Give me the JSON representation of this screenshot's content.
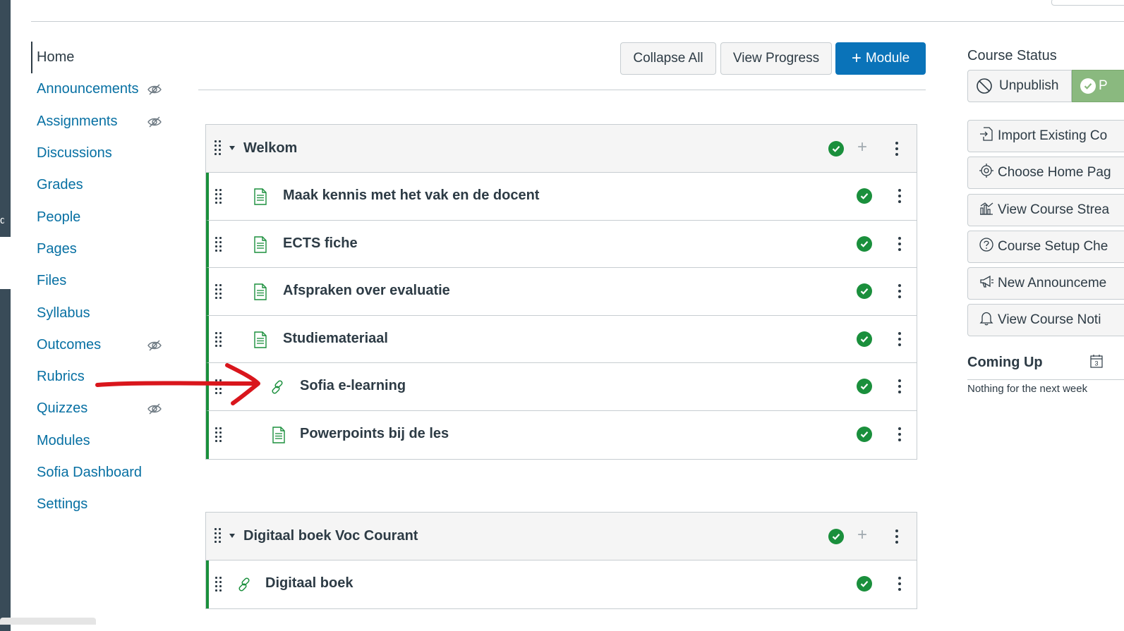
{
  "nav": {
    "items": [
      {
        "label": "Home",
        "active": true,
        "hidden": false
      },
      {
        "label": "Announcements",
        "active": false,
        "hidden": true
      },
      {
        "label": "Assignments",
        "active": false,
        "hidden": true
      },
      {
        "label": "Discussions",
        "active": false,
        "hidden": false
      },
      {
        "label": "Grades",
        "active": false,
        "hidden": false
      },
      {
        "label": "People",
        "active": false,
        "hidden": false
      },
      {
        "label": "Pages",
        "active": false,
        "hidden": false
      },
      {
        "label": "Files",
        "active": false,
        "hidden": false
      },
      {
        "label": "Syllabus",
        "active": false,
        "hidden": false
      },
      {
        "label": "Outcomes",
        "active": false,
        "hidden": true
      },
      {
        "label": "Rubrics",
        "active": false,
        "hidden": false
      },
      {
        "label": "Quizzes",
        "active": false,
        "hidden": true
      },
      {
        "label": "Modules",
        "active": false,
        "hidden": false
      },
      {
        "label": "Sofia Dashboard",
        "active": false,
        "hidden": false
      },
      {
        "label": "Settings",
        "active": false,
        "hidden": false
      }
    ]
  },
  "left_strip_text": "d",
  "toolbar": {
    "collapse_all": "Collapse All",
    "view_progress": "View Progress",
    "add_module": "Module"
  },
  "modules": [
    {
      "title": "Welkom",
      "items": [
        {
          "title": "Maak kennis met het vak en de docent",
          "type": "page-icon",
          "indent": 0
        },
        {
          "title": "ECTS fiche",
          "type": "page-icon",
          "indent": 0
        },
        {
          "title": "Afspraken over evaluatie",
          "type": "page-icon",
          "indent": 0
        },
        {
          "title": "Studiemateriaal",
          "type": "page-icon",
          "indent": 0
        },
        {
          "title": "Sofia e-learning",
          "type": "link-icon",
          "indent": 1
        },
        {
          "title": "Powerpoints bij de les",
          "type": "page-icon",
          "indent": 1
        }
      ]
    },
    {
      "title": "Digitaal boek Voc Courant",
      "items": [
        {
          "title": "Digitaal boek",
          "type": "link-icon",
          "indent": 0
        }
      ]
    }
  ],
  "sidebar": {
    "course_status": "Course Status",
    "unpublish": "Unpublish",
    "publish": "P",
    "buttons": [
      {
        "label": "Import Existing Co",
        "icon": "import-icon"
      },
      {
        "label": "Choose Home Pag",
        "icon": "target-icon"
      },
      {
        "label": "View Course Strea",
        "icon": "stream-chart-icon"
      },
      {
        "label": "Course Setup Che",
        "icon": "question-icon"
      },
      {
        "label": "New Announceme",
        "icon": "megaphone-icon"
      },
      {
        "label": "View Course Noti",
        "icon": "bell-icon"
      }
    ],
    "coming_up": "Coming Up",
    "calendar_day": "3",
    "nothing": "Nothing for the next week"
  },
  "colors": {
    "link": "#0770a3",
    "primary": "#0a73b9",
    "published_green": "#1a8f3c",
    "annotation_red": "#d9161c"
  }
}
